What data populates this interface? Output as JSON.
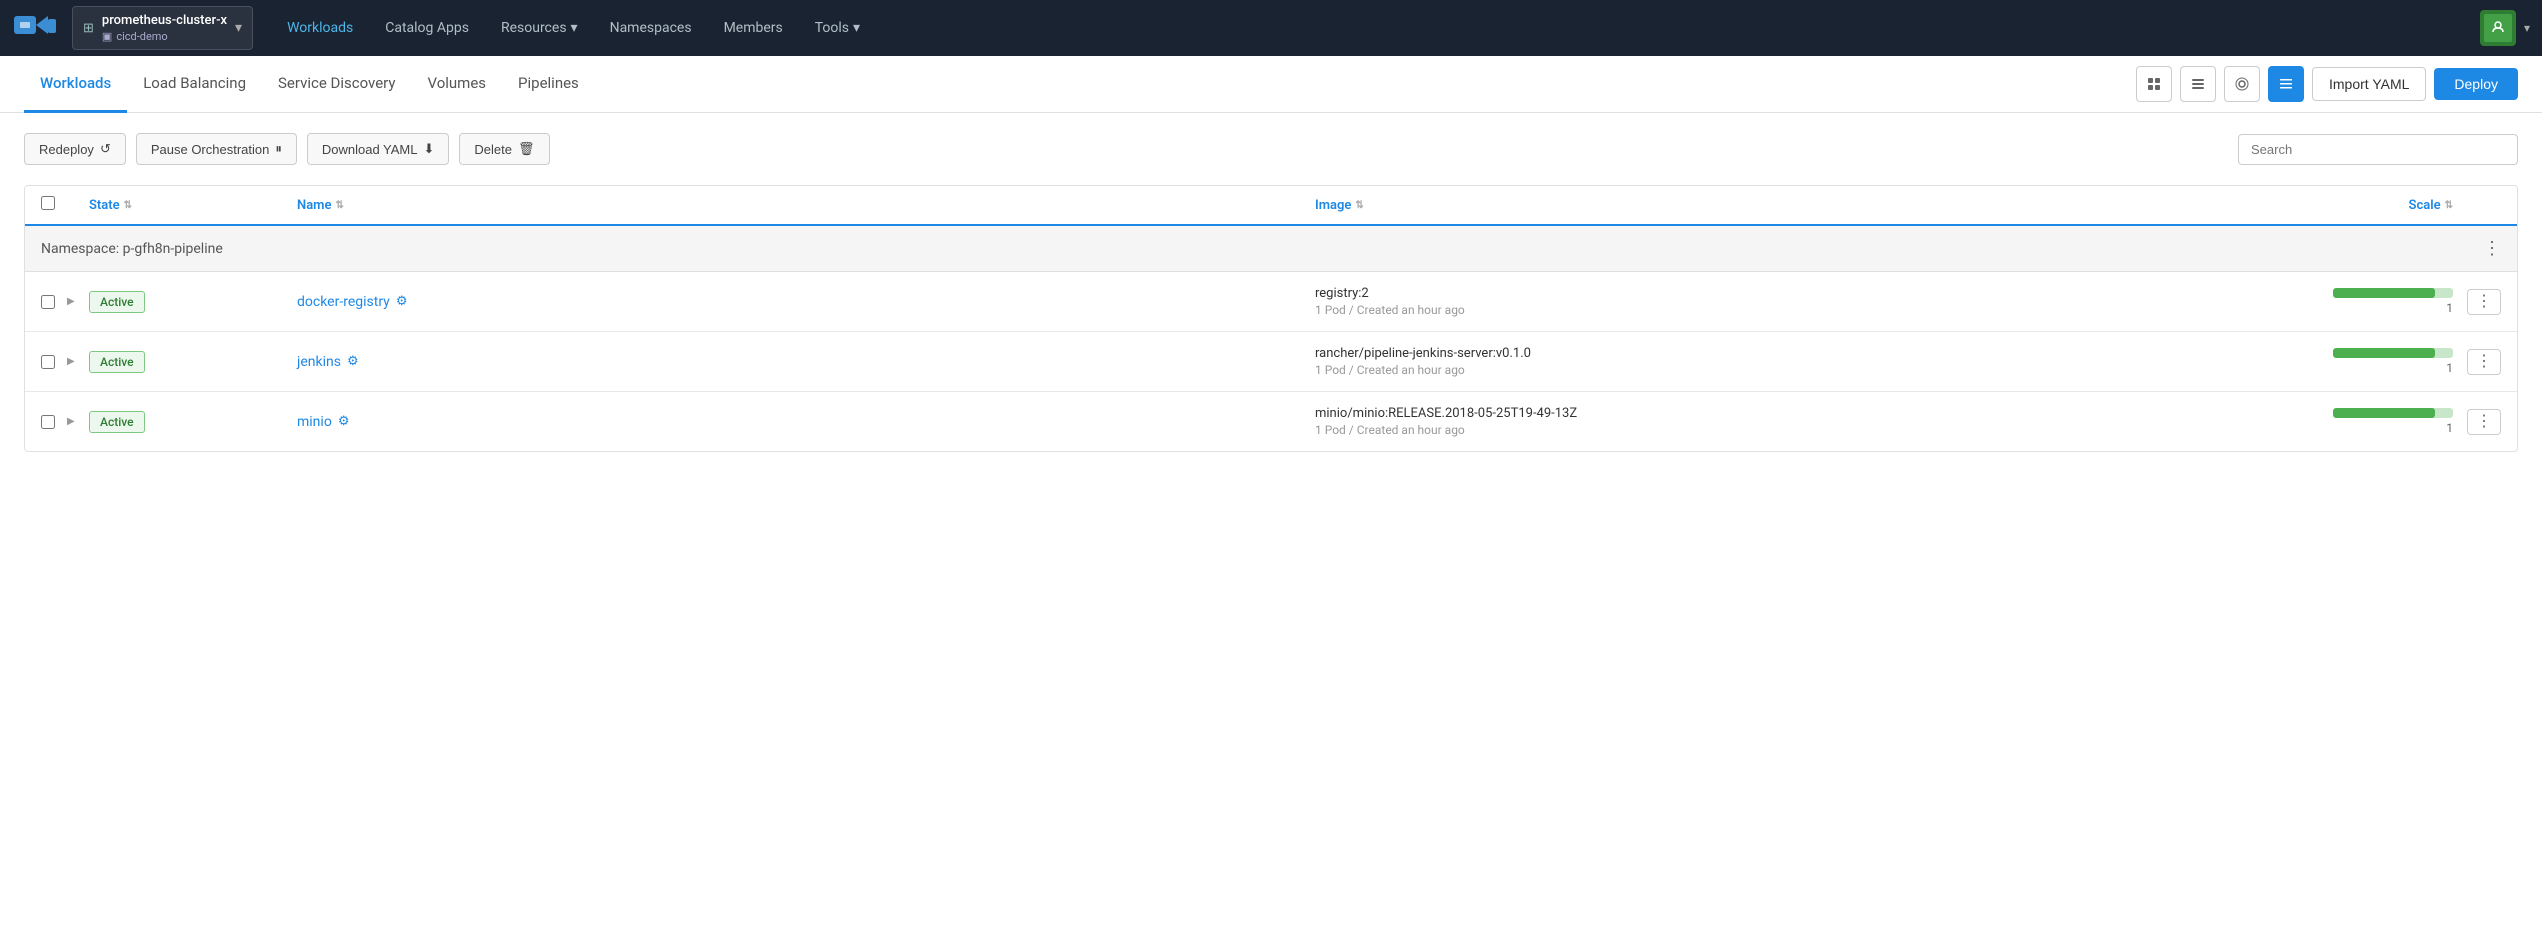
{
  "nav": {
    "cluster_name": "prometheus-cluster-x",
    "project_name": "cicd-demo",
    "links": [
      {
        "label": "Workloads",
        "active": true
      },
      {
        "label": "Catalog Apps",
        "active": false
      },
      {
        "label": "Resources",
        "active": false,
        "dropdown": true
      },
      {
        "label": "Namespaces",
        "active": false
      },
      {
        "label": "Members",
        "active": false
      },
      {
        "label": "Tools",
        "active": false,
        "dropdown": true
      }
    ]
  },
  "sub_nav": {
    "tabs": [
      {
        "label": "Workloads",
        "active": true
      },
      {
        "label": "Load Balancing",
        "active": false
      },
      {
        "label": "Service Discovery",
        "active": false
      },
      {
        "label": "Volumes",
        "active": false
      },
      {
        "label": "Pipelines",
        "active": false
      }
    ],
    "import_yaml_label": "Import YAML",
    "deploy_label": "Deploy"
  },
  "toolbar": {
    "redeploy_label": "Redeploy",
    "pause_label": "Pause Orchestration",
    "download_label": "Download YAML",
    "delete_label": "Delete",
    "search_placeholder": "Search"
  },
  "table": {
    "columns": [
      {
        "label": "State",
        "sortable": true
      },
      {
        "label": "Name",
        "sortable": true
      },
      {
        "label": "Image",
        "sortable": true
      },
      {
        "label": "Scale",
        "sortable": true
      }
    ],
    "namespace_group": {
      "label": "Namespace: p-gfh8n-pipeline"
    },
    "rows": [
      {
        "state": "Active",
        "name": "docker-registry",
        "image": "registry:2",
        "meta": "1 Pod / Created an hour ago",
        "scale": 1,
        "scale_pct": 85
      },
      {
        "state": "Active",
        "name": "jenkins",
        "image": "rancher/pipeline-jenkins-server:v0.1.0",
        "meta": "1 Pod / Created an hour ago",
        "scale": 1,
        "scale_pct": 85
      },
      {
        "state": "Active",
        "name": "minio",
        "image": "minio/minio:RELEASE.2018-05-25T19-49-13Z",
        "meta": "1 Pod / Created an hour ago",
        "scale": 1,
        "scale_pct": 85
      }
    ]
  }
}
